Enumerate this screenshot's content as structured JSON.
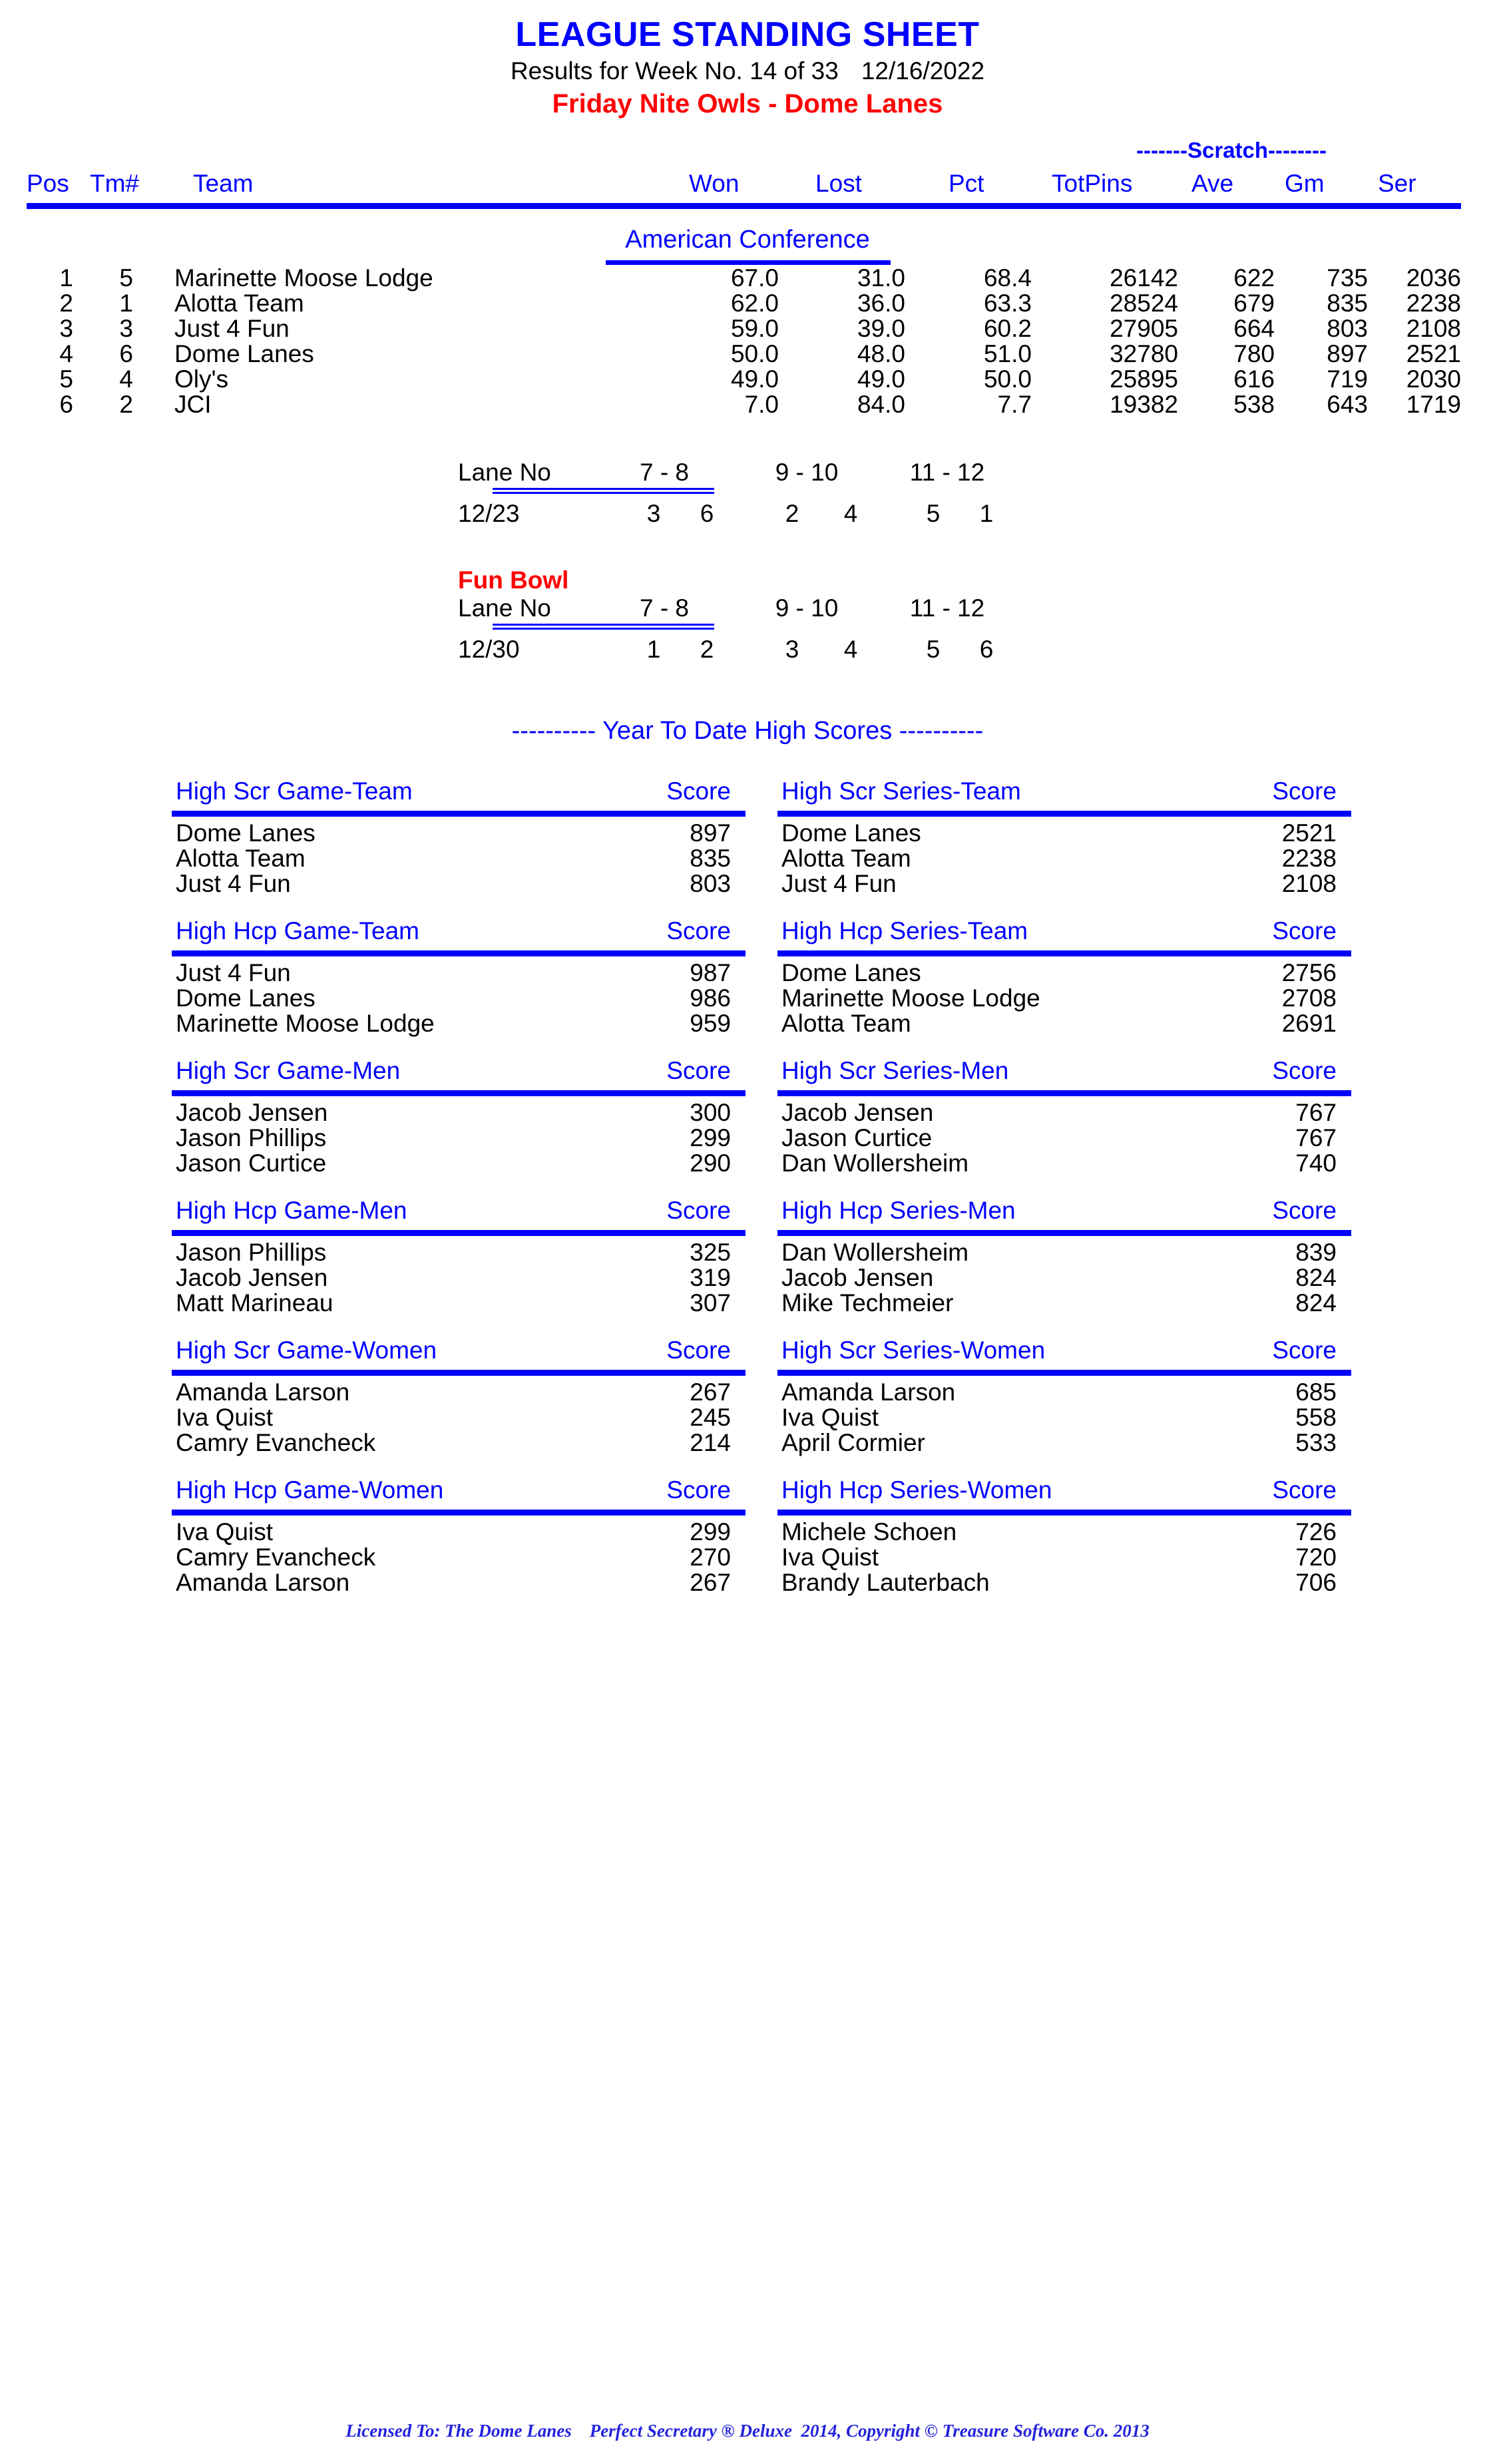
{
  "header": {
    "title": "LEAGUE STANDING SHEET",
    "results_label": "Results for Week No. 14 of 33",
    "date": "12/16/2022",
    "league": "Friday Nite Owls - Dome Lanes",
    "title_color": "#0000ff",
    "league_color": "#ff0000"
  },
  "standings": {
    "group_label": "-------Scratch--------",
    "conference": "American Conference",
    "columns": {
      "pos": "Pos",
      "tm": "Tm#",
      "team": "Team",
      "won": "Won",
      "lost": "Lost",
      "pct": "Pct",
      "totpins": "TotPins",
      "ave": "Ave",
      "gm": "Gm",
      "ser": "Ser"
    },
    "rows": [
      {
        "pos": "1",
        "tm": "5",
        "team": "Marinette Moose Lodge",
        "won": "67.0",
        "lost": "31.0",
        "pct": "68.4",
        "totpins": "26142",
        "ave": "622",
        "gm": "735",
        "ser": "2036"
      },
      {
        "pos": "2",
        "tm": "1",
        "team": "Alotta Team",
        "won": "62.0",
        "lost": "36.0",
        "pct": "63.3",
        "totpins": "28524",
        "ave": "679",
        "gm": "835",
        "ser": "2238"
      },
      {
        "pos": "3",
        "tm": "3",
        "team": "Just 4 Fun",
        "won": "59.0",
        "lost": "39.0",
        "pct": "60.2",
        "totpins": "27905",
        "ave": "664",
        "gm": "803",
        "ser": "2108"
      },
      {
        "pos": "4",
        "tm": "6",
        "team": "Dome Lanes",
        "won": "50.0",
        "lost": "48.0",
        "pct": "51.0",
        "totpins": "32780",
        "ave": "780",
        "gm": "897",
        "ser": "2521"
      },
      {
        "pos": "5",
        "tm": "4",
        "team": "Oly's",
        "won": "49.0",
        "lost": "49.0",
        "pct": "50.0",
        "totpins": "25895",
        "ave": "616",
        "gm": "719",
        "ser": "2030"
      },
      {
        "pos": "6",
        "tm": "2",
        "team": "JCI",
        "won": "7.0",
        "lost": "84.0",
        "pct": "7.7",
        "totpins": "19382",
        "ave": "538",
        "gm": "643",
        "ser": "1719"
      }
    ]
  },
  "lane_schedule": {
    "lane_label": "Lane No",
    "lane_pairs": [
      "7 -  8",
      "9 - 10",
      "11 - 12"
    ],
    "blocks": [
      {
        "title": "",
        "date": "12/23",
        "teams": [
          "3",
          "6",
          "2",
          "4",
          "5",
          "1"
        ]
      },
      {
        "title": "Fun Bowl",
        "date": "12/30",
        "teams": [
          "1",
          "2",
          "3",
          "4",
          "5",
          "6"
        ]
      }
    ]
  },
  "ytd": {
    "title": "---------- Year To Date High Scores ----------",
    "score_label": "Score",
    "groups": [
      {
        "left": {
          "header": "High Scr Game-Team",
          "rows": [
            {
              "name": "Dome Lanes",
              "score": "897"
            },
            {
              "name": "Alotta Team",
              "score": "835"
            },
            {
              "name": "Just 4 Fun",
              "score": "803"
            }
          ]
        },
        "right": {
          "header": "High Scr Series-Team",
          "rows": [
            {
              "name": "Dome Lanes",
              "score": "2521"
            },
            {
              "name": "Alotta Team",
              "score": "2238"
            },
            {
              "name": "Just 4 Fun",
              "score": "2108"
            }
          ]
        }
      },
      {
        "left": {
          "header": "High Hcp Game-Team",
          "rows": [
            {
              "name": "Just 4 Fun",
              "score": "987"
            },
            {
              "name": "Dome Lanes",
              "score": "986"
            },
            {
              "name": "Marinette Moose Lodge",
              "score": "959"
            }
          ]
        },
        "right": {
          "header": "High Hcp Series-Team",
          "rows": [
            {
              "name": "Dome Lanes",
              "score": "2756"
            },
            {
              "name": "Marinette Moose Lodge",
              "score": "2708"
            },
            {
              "name": "Alotta Team",
              "score": "2691"
            }
          ]
        }
      },
      {
        "left": {
          "header": "High Scr Game-Men",
          "rows": [
            {
              "name": "Jacob Jensen",
              "score": "300"
            },
            {
              "name": "Jason Phillips",
              "score": "299"
            },
            {
              "name": "Jason Curtice",
              "score": "290"
            }
          ]
        },
        "right": {
          "header": "High Scr Series-Men",
          "rows": [
            {
              "name": "Jacob Jensen",
              "score": "767"
            },
            {
              "name": "Jason Curtice",
              "score": "767"
            },
            {
              "name": "Dan Wollersheim",
              "score": "740"
            }
          ]
        }
      },
      {
        "left": {
          "header": "High Hcp Game-Men",
          "rows": [
            {
              "name": "Jason Phillips",
              "score": "325"
            },
            {
              "name": "Jacob Jensen",
              "score": "319"
            },
            {
              "name": "Matt Marineau",
              "score": "307"
            }
          ]
        },
        "right": {
          "header": "High Hcp Series-Men",
          "rows": [
            {
              "name": "Dan Wollersheim",
              "score": "839"
            },
            {
              "name": "Jacob Jensen",
              "score": "824"
            },
            {
              "name": "Mike Techmeier",
              "score": "824"
            }
          ]
        }
      },
      {
        "left": {
          "header": "High Scr Game-Women",
          "rows": [
            {
              "name": "Amanda Larson",
              "score": "267"
            },
            {
              "name": "Iva Quist",
              "score": "245"
            },
            {
              "name": "Camry Evancheck",
              "score": "214"
            }
          ]
        },
        "right": {
          "header": "High Scr Series-Women",
          "rows": [
            {
              "name": "Amanda Larson",
              "score": "685"
            },
            {
              "name": "Iva Quist",
              "score": "558"
            },
            {
              "name": "April Cormier",
              "score": "533"
            }
          ]
        }
      },
      {
        "left": {
          "header": "High Hcp Game-Women",
          "rows": [
            {
              "name": "Iva Quist",
              "score": "299"
            },
            {
              "name": "Camry Evancheck",
              "score": "270"
            },
            {
              "name": "Amanda Larson",
              "score": "267"
            }
          ]
        },
        "right": {
          "header": "High Hcp Series-Women",
          "rows": [
            {
              "name": "Michele Schoen",
              "score": "726"
            },
            {
              "name": "Iva Quist",
              "score": "720"
            },
            {
              "name": "Brandy Lauterbach",
              "score": "706"
            }
          ]
        }
      }
    ]
  },
  "footer": {
    "text": "Licensed To: The Dome Lanes    Perfect Secretary ® Deluxe  2014, Copyright © Treasure Software Co. 2013"
  }
}
